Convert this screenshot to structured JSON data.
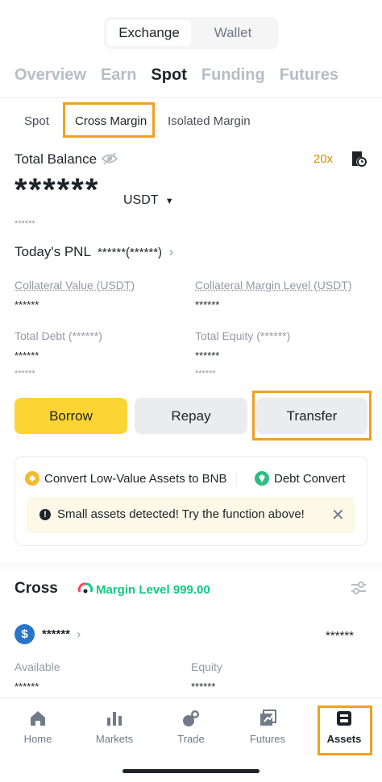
{
  "top_toggle": {
    "exchange": "Exchange",
    "wallet": "Wallet"
  },
  "main_tabs": [
    "Overview",
    "Earn",
    "Spot",
    "Funding",
    "Futures"
  ],
  "sub_tabs": [
    "Spot",
    "Cross Margin",
    "Isolated Margin"
  ],
  "balance": {
    "label": "Total Balance",
    "leverage": "20x",
    "amount": "******",
    "currency": "USDT",
    "sub_value": "******",
    "pnl_label": "Today's PNL",
    "pnl_value": "******(******)"
  },
  "stats": {
    "collateral_value_label": "Collateral Value (USDT)",
    "collateral_value": "******",
    "collateral_margin_label": "Collateral Margin Level (USDT)",
    "collateral_margin": "******",
    "total_debt_label": "Total Debt (******)",
    "total_debt": "******",
    "total_debt_sub": "******",
    "total_equity_label": "Total Equity (******)",
    "total_equity": "******",
    "total_equity_sub": "******"
  },
  "actions": {
    "borrow": "Borrow",
    "repay": "Repay",
    "transfer": "Transfer"
  },
  "convert_card": {
    "convert_bnb": "Convert Low-Value Assets to BNB",
    "debt_convert": "Debt Convert",
    "warning": "Small assets detected! Try the function above!"
  },
  "cross": {
    "title": "Cross",
    "margin_level": "Margin Level 999.00",
    "asset_name": "******",
    "asset_value": "******",
    "available_label": "Available",
    "available_value": "******",
    "equity_label": "Equity",
    "equity_value": "******"
  },
  "bottom_nav": [
    "Home",
    "Markets",
    "Trade",
    "Futures",
    "Assets"
  ],
  "colors": {
    "accent": "#fcd535",
    "highlight": "#f0a020",
    "green": "#0ecb81",
    "usdc_blue": "#2775ca"
  }
}
